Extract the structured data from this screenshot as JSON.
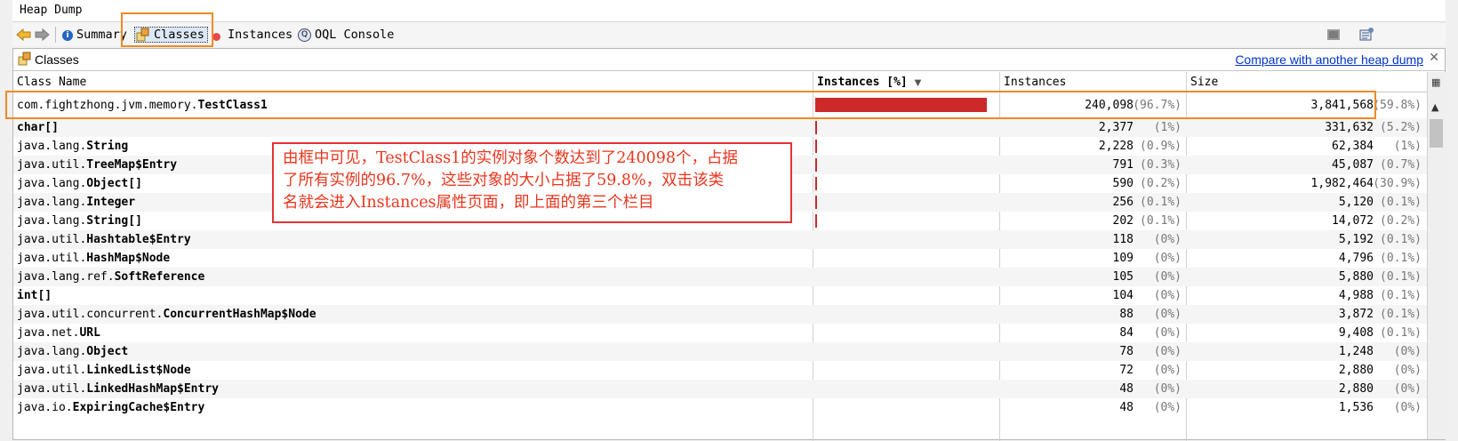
{
  "window": {
    "title": "Heap Dump"
  },
  "toolbar": {
    "summary_label": "Summary",
    "classes_label": "Classes",
    "instances_label": "Instances",
    "oql_label": "OQL Console"
  },
  "panel": {
    "title": "Classes",
    "compare_link": "Compare with another heap dump",
    "close_glyph": "✕"
  },
  "table": {
    "headers": {
      "class_name": "Class Name",
      "instances_pct": "Instances [%]",
      "instances": "Instances",
      "size": "Size"
    },
    "sort_indicator": "▼",
    "rows": [
      {
        "pkg": "com.fightzhong.jvm.memory.",
        "cls": "TestClass1",
        "pct": 96.7,
        "instances": "240,098",
        "inst_pct": "(96.7%)",
        "size": "3,841,568",
        "size_pct": "(59.8%)"
      },
      {
        "pkg": "",
        "cls": "char[]",
        "pct": 1,
        "instances": "2,377",
        "inst_pct": "(1%)",
        "size": "331,632",
        "size_pct": "(5.2%)"
      },
      {
        "pkg": "java.lang.",
        "cls": "String",
        "pct": 0.9,
        "instances": "2,228",
        "inst_pct": "(0.9%)",
        "size": "62,384",
        "size_pct": "(1%)"
      },
      {
        "pkg": "java.util.",
        "cls": "TreeMap$Entry",
        "pct": 0.3,
        "instances": "791",
        "inst_pct": "(0.3%)",
        "size": "45,087",
        "size_pct": "(0.7%)"
      },
      {
        "pkg": "java.lang.",
        "cls": "Object[]",
        "pct": 0.2,
        "instances": "590",
        "inst_pct": "(0.2%)",
        "size": "1,982,464",
        "size_pct": "(30.9%)"
      },
      {
        "pkg": "java.lang.",
        "cls": "Integer",
        "pct": 0.1,
        "instances": "256",
        "inst_pct": "(0.1%)",
        "size": "5,120",
        "size_pct": "(0.1%)"
      },
      {
        "pkg": "java.lang.",
        "cls": "String[]",
        "pct": 0.1,
        "instances": "202",
        "inst_pct": "(0.1%)",
        "size": "14,072",
        "size_pct": "(0.2%)"
      },
      {
        "pkg": "java.util.",
        "cls": "Hashtable$Entry",
        "pct": 0,
        "instances": "118",
        "inst_pct": "(0%)",
        "size": "5,192",
        "size_pct": "(0.1%)"
      },
      {
        "pkg": "java.util.",
        "cls": "HashMap$Node",
        "pct": 0,
        "instances": "109",
        "inst_pct": "(0%)",
        "size": "4,796",
        "size_pct": "(0.1%)"
      },
      {
        "pkg": "java.lang.ref.",
        "cls": "SoftReference",
        "pct": 0,
        "instances": "105",
        "inst_pct": "(0%)",
        "size": "5,880",
        "size_pct": "(0.1%)"
      },
      {
        "pkg": "",
        "cls": "int[]",
        "pct": 0,
        "instances": "104",
        "inst_pct": "(0%)",
        "size": "4,988",
        "size_pct": "(0.1%)"
      },
      {
        "pkg": "java.util.concurrent.",
        "cls": "ConcurrentHashMap$Node",
        "pct": 0,
        "instances": "88",
        "inst_pct": "(0%)",
        "size": "3,872",
        "size_pct": "(0.1%)"
      },
      {
        "pkg": "java.net.",
        "cls": "URL",
        "pct": 0,
        "instances": "84",
        "inst_pct": "(0%)",
        "size": "9,408",
        "size_pct": "(0.1%)"
      },
      {
        "pkg": "java.lang.",
        "cls": "Object",
        "pct": 0,
        "instances": "78",
        "inst_pct": "(0%)",
        "size": "1,248",
        "size_pct": "(0%)"
      },
      {
        "pkg": "java.util.",
        "cls": "LinkedList$Node",
        "pct": 0,
        "instances": "72",
        "inst_pct": "(0%)",
        "size": "2,880",
        "size_pct": "(0%)"
      },
      {
        "pkg": "java.util.",
        "cls": "LinkedHashMap$Entry",
        "pct": 0,
        "instances": "48",
        "inst_pct": "(0%)",
        "size": "2,880",
        "size_pct": "(0%)"
      },
      {
        "pkg": "java.io.",
        "cls": "ExpiringCache$Entry",
        "pct": 0,
        "instances": "48",
        "inst_pct": "(0%)",
        "size": "1,536",
        "size_pct": "(0%)"
      }
    ]
  },
  "annotation": {
    "lines": [
      "由框中可见，TestClass1的实例对象个数达到了240098个，占据",
      "了所有实例的96.7%，这些对象的大小占据了59.8%，双击该类",
      "名就会进入Instances属性页面，即上面的第三个栏目"
    ]
  },
  "colors": {
    "bar": "#cc2a2a",
    "highlight_box": "#f08a24",
    "note_border": "#e53333",
    "note_text": "#e8361e",
    "link": "#0033cc"
  }
}
